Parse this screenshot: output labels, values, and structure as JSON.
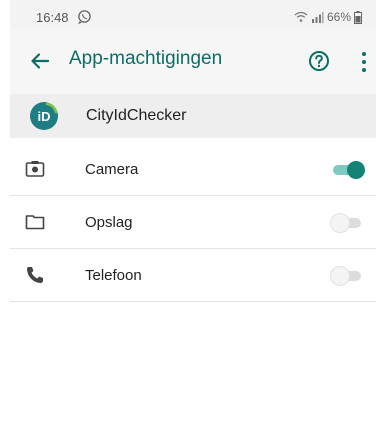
{
  "status_bar": {
    "time": "16:48",
    "battery": "66%",
    "icons": [
      "whatsapp-icon",
      "wifi-icon",
      "signal-icon",
      "battery-icon"
    ]
  },
  "toolbar": {
    "title": "App-machtigingen",
    "icons": [
      "back-arrow-icon",
      "help-icon",
      "more-vert-icon"
    ]
  },
  "app": {
    "name": "CityIdChecker",
    "icon": "cityidchecker-logo"
  },
  "permissions": [
    {
      "label": "Camera",
      "icon": "camera-icon",
      "enabled": true
    },
    {
      "label": "Opslag",
      "icon": "folder-icon",
      "enabled": false
    },
    {
      "label": "Telefoon",
      "icon": "phone-icon",
      "enabled": false
    }
  ],
  "colors": {
    "accent": "#0a6e66",
    "toggle_on_thumb": "#138376",
    "toggle_on_track": "#7ec9c1",
    "toggle_off_track": "#dcdcdc"
  }
}
